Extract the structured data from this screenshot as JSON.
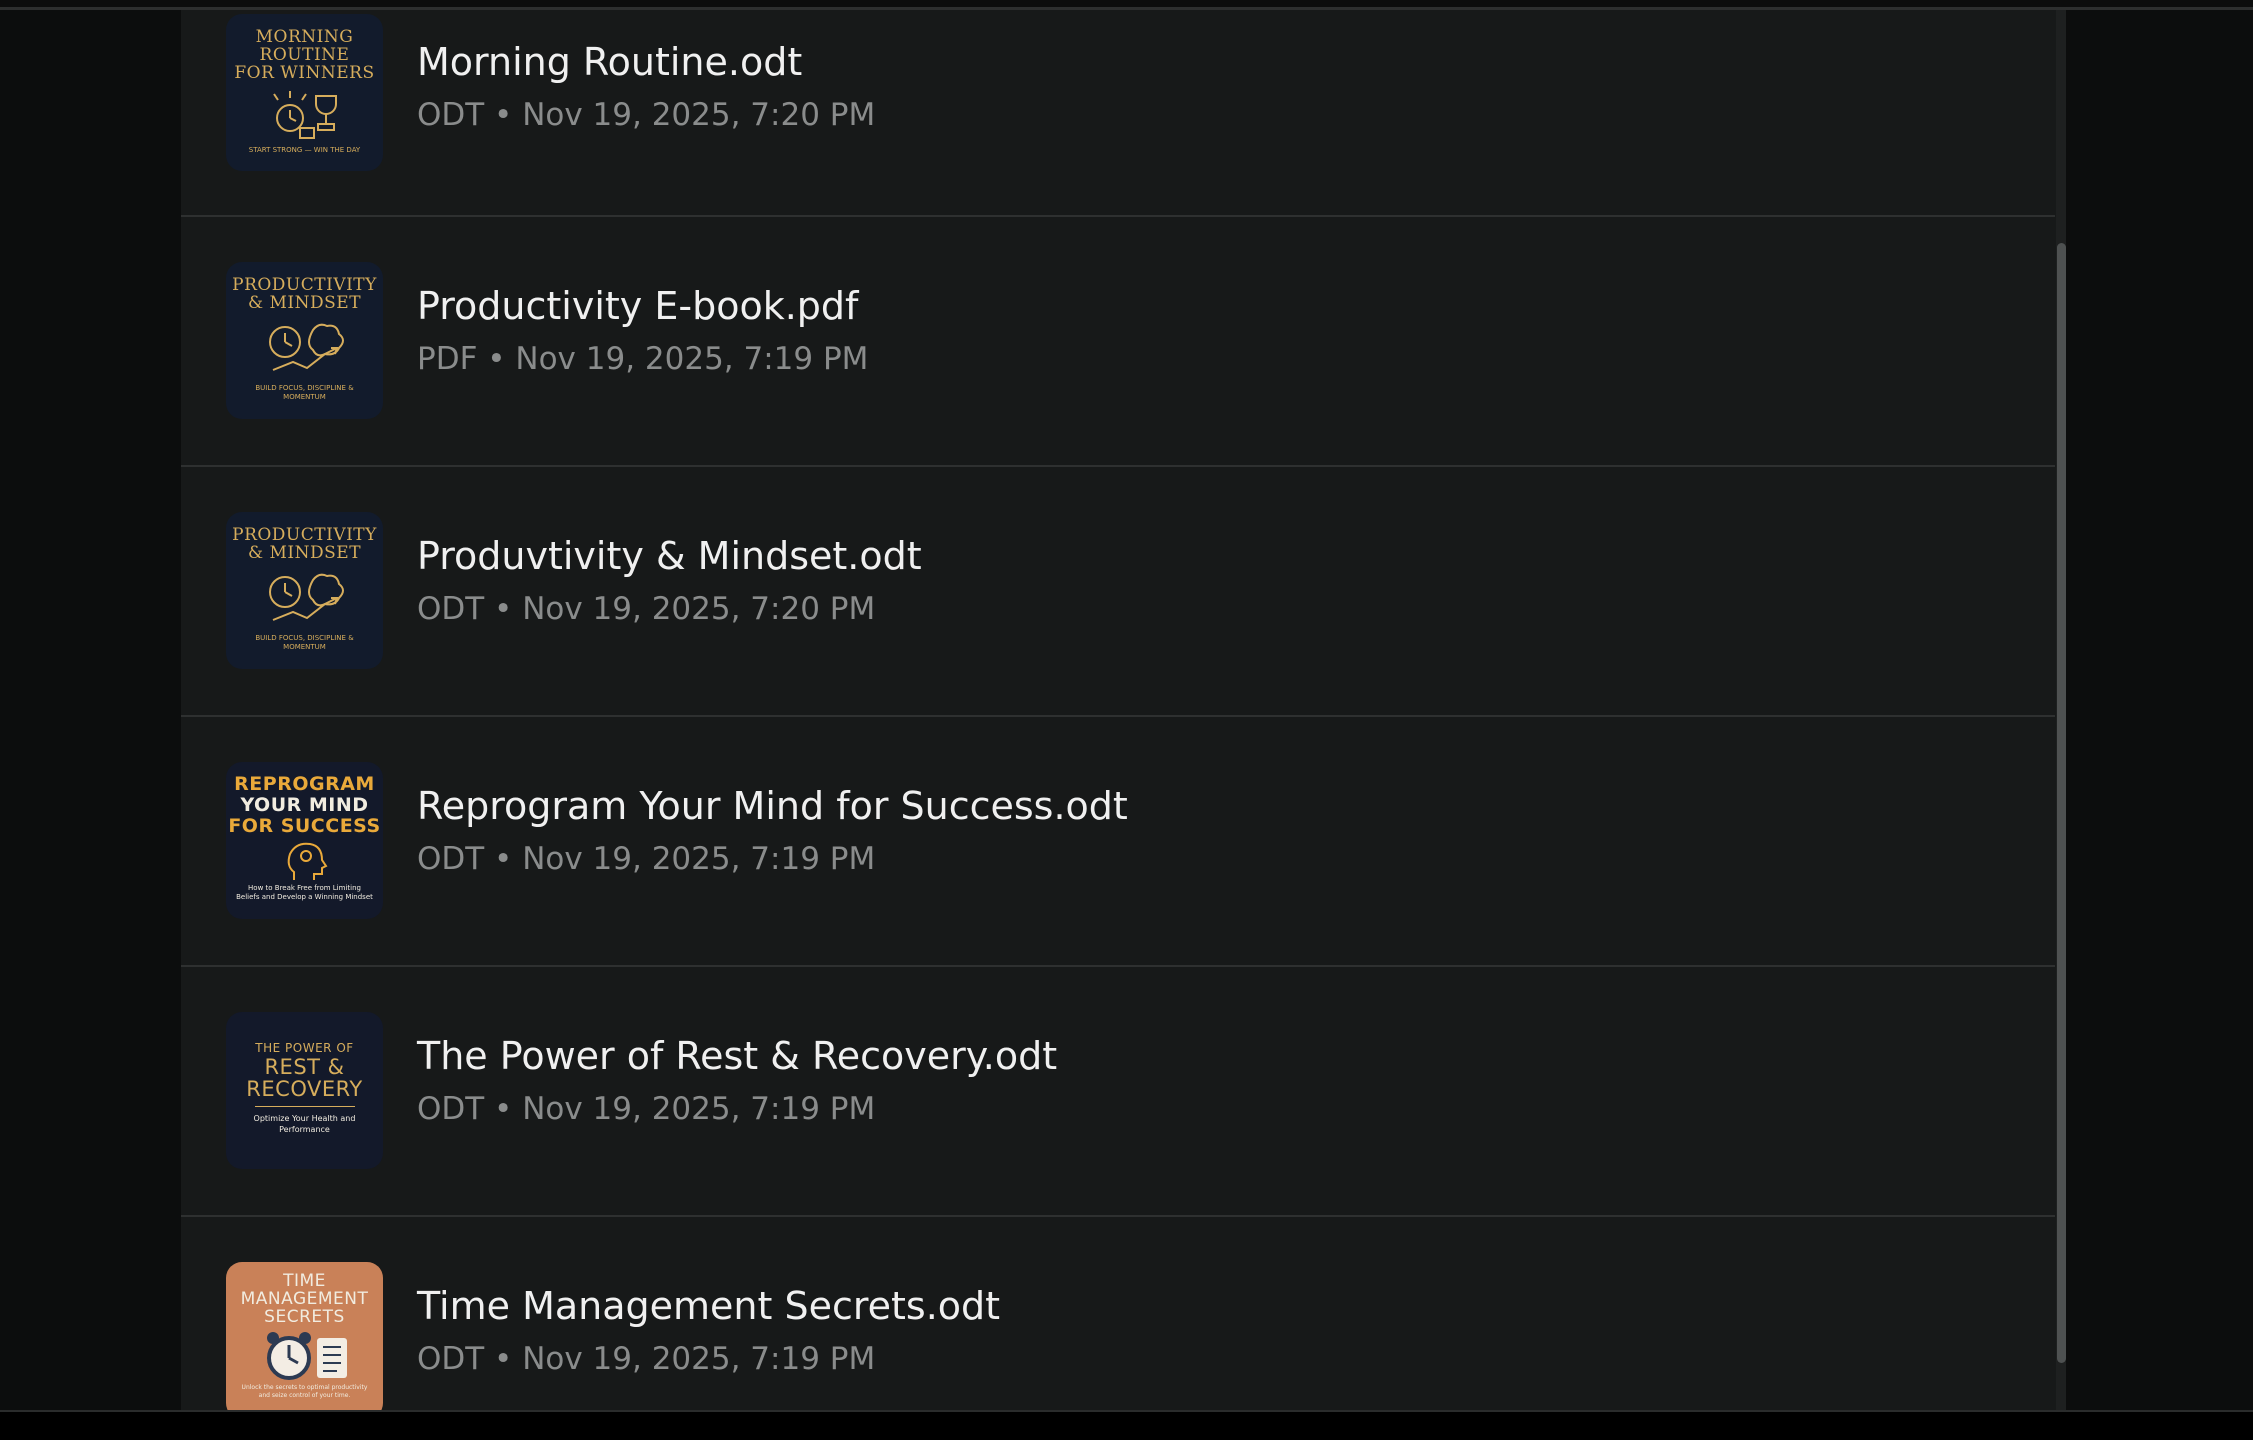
{
  "files": [
    {
      "title": "Morning Routine.odt",
      "meta": "ODT • Nov 19, 2025, 7:20 PM",
      "cover": {
        "lines": [
          "MORNING",
          "ROUTINE",
          "FOR WINNERS"
        ],
        "subtitle": "START STRONG — WIN THE DAY",
        "style": "navy",
        "icon": "alarm-clock-trophy-icon"
      }
    },
    {
      "title": "Productivity E-book.pdf",
      "meta": "PDF • Nov 19, 2025, 7:19 PM",
      "cover": {
        "lines": [
          "PRODUCTIVITY",
          "& MINDSET"
        ],
        "subtitle": "BUILD FOCUS, DISCIPLINE & MOMENTUM",
        "style": "navy",
        "icon": "clock-brain-icon"
      }
    },
    {
      "title": "Produvtivity & Mindset.odt",
      "meta": "ODT • Nov 19, 2025, 7:20 PM",
      "cover": {
        "lines": [
          "PRODUCTIVITY",
          "& MINDSET"
        ],
        "subtitle": "BUILD FOCUS, DISCIPLINE & MOMENTUM",
        "style": "navy",
        "icon": "clock-brain-icon"
      }
    },
    {
      "title": "Reprogram Your Mind for Success.odt",
      "meta": "ODT • Nov 19, 2025, 7:19 PM",
      "cover": {
        "lines": [
          "REPROGRAM",
          "YOUR MIND",
          "FOR SUCCESS"
        ],
        "subtitle": "How to Break Free from Limiting Beliefs and Develop a Winning Mindset",
        "style": "navy2",
        "icon": "head-gear-icon"
      }
    },
    {
      "title": "The Power of Rest & Recovery.odt",
      "meta": "ODT • Nov 19, 2025, 7:19 PM",
      "cover": {
        "lines": [
          "THE POWER OF",
          "REST &",
          "RECOVERY"
        ],
        "subtitle": "Optimize Your Health and Performance",
        "style": "navy2",
        "icon": ""
      }
    },
    {
      "title": "Time Management Secrets.odt",
      "meta": "ODT • Nov 19, 2025, 7:19 PM",
      "cover": {
        "lines": [
          "TIME",
          "MANAGEMENT",
          "SECRETS"
        ],
        "subtitle": "Unlock the secrets to optimal productivity and seize control of your time.",
        "style": "orange",
        "icon": "alarm-clock-checklist-icon"
      }
    }
  ]
}
